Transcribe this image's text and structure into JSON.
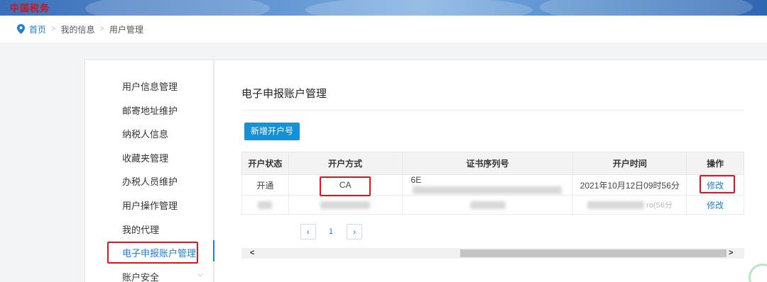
{
  "banner": {
    "logo_text": "中国税务"
  },
  "breadcrumb": {
    "home": "首页",
    "sep": ">",
    "my_info": "我的信息",
    "current": "用户管理"
  },
  "sidebar": {
    "items": [
      {
        "label": "用户信息管理"
      },
      {
        "label": "邮寄地址维护"
      },
      {
        "label": "纳税人信息"
      },
      {
        "label": "收藏夹管理"
      },
      {
        "label": "办税人员维护"
      },
      {
        "label": "用户操作管理"
      },
      {
        "label": "我的代理"
      },
      {
        "label": "电子申报账户管理"
      },
      {
        "label": "账户安全"
      }
    ],
    "active_index": 7,
    "expand_icon": "chevron-down-icon"
  },
  "main": {
    "title": "电子申报账户管理",
    "add_button": "新增开户号",
    "table": {
      "headers": [
        "开户状态",
        "开户方式",
        "证书序列号",
        "开户时间",
        "操作"
      ],
      "rows": [
        {
          "status": "开通",
          "method": "CA",
          "serial_prefix": "6E",
          "time": "2021年10月12日09时56分",
          "action": "修改"
        },
        {
          "status": "",
          "method": "",
          "serial_prefix": "",
          "time": "",
          "time_tail": "ro(56分",
          "action": "修改"
        }
      ]
    },
    "pager": {
      "prev": "‹",
      "page": "1",
      "next": "›"
    },
    "scroll": {
      "left": "<",
      "right": ">"
    }
  },
  "colors": {
    "accent": "#1b7fd4",
    "button": "#1790d6",
    "highlight": "#e0151d"
  }
}
